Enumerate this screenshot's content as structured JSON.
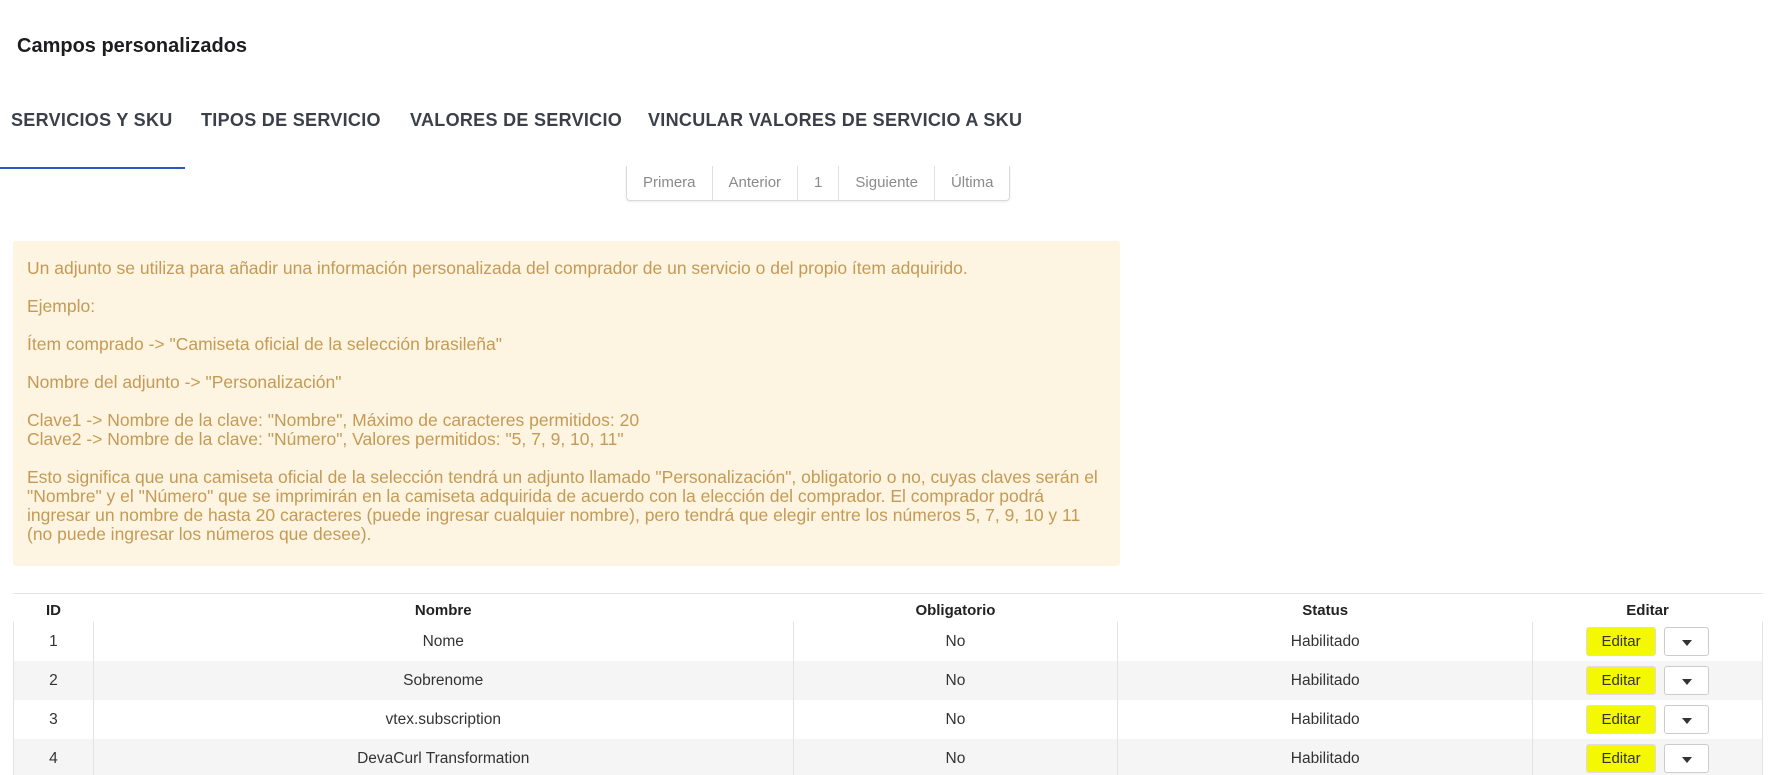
{
  "page": {
    "title": "Campos personalizados"
  },
  "tabs": [
    {
      "label": "SERVICIOS Y SKU",
      "active": true
    },
    {
      "label": "TIPOS DE SERVICIO",
      "active": false
    },
    {
      "label": "VALORES DE SERVICIO",
      "active": false
    },
    {
      "label": "VINCULAR VALORES DE SERVICIO A SKU",
      "active": false
    }
  ],
  "pagination": {
    "first": "Primera",
    "prev": "Anterior",
    "current": "1",
    "next": "Siguiente",
    "last": "Última"
  },
  "info": {
    "line1": "Un adjunto se utiliza para añadir una información personalizada del comprador de un servicio o del propio ítem adquirido.",
    "line2": "Ejemplo:",
    "line3": "Ítem comprado -> \"Camiseta oficial de la selección brasileña\"",
    "line4": "Nombre del adjunto -> \"Personalización\"",
    "line5": "Clave1 -> Nombre de la clave: \"Nombre\", Máximo de caracteres permitidos: 20",
    "line6": "Clave2 -> Nombre de la clave: \"Número\", Valores permitidos: \"5, 7, 9, 10, 11\"",
    "line7": "Esto significa que una camiseta oficial de la selección tendrá un adjunto llamado \"Personalización\", obligatorio o no, cuyas claves serán el \"Nombre\" y el \"Número\" que se imprimirán en la camiseta adquirida de acuerdo con la elección del comprador. El comprador podrá ingresar un nombre de hasta 20 caracteres (puede ingresar cualquier nombre), pero tendrá que elegir entre los números 5, 7, 9, 10 y 11 (no puede ingresar los números que desee)."
  },
  "table": {
    "headers": {
      "id": "ID",
      "name": "Nombre",
      "required": "Obligatorio",
      "status": "Status",
      "edit": "Editar"
    },
    "edit_label": "Editar",
    "rows": [
      {
        "id": "1",
        "name": "Nome",
        "required": "No",
        "status": "Habilitado"
      },
      {
        "id": "2",
        "name": "Sobrenome",
        "required": "No",
        "status": "Habilitado"
      },
      {
        "id": "3",
        "name": "vtex.subscription",
        "required": "No",
        "status": "Habilitado"
      },
      {
        "id": "4",
        "name": "DevaCurl Transformation",
        "required": "No",
        "status": "Habilitado"
      }
    ]
  },
  "colors": {
    "accent": "#2b59c3",
    "info_bg": "#fdf5e1",
    "info_text": "#c49a56",
    "highlight": "#f4f800"
  }
}
